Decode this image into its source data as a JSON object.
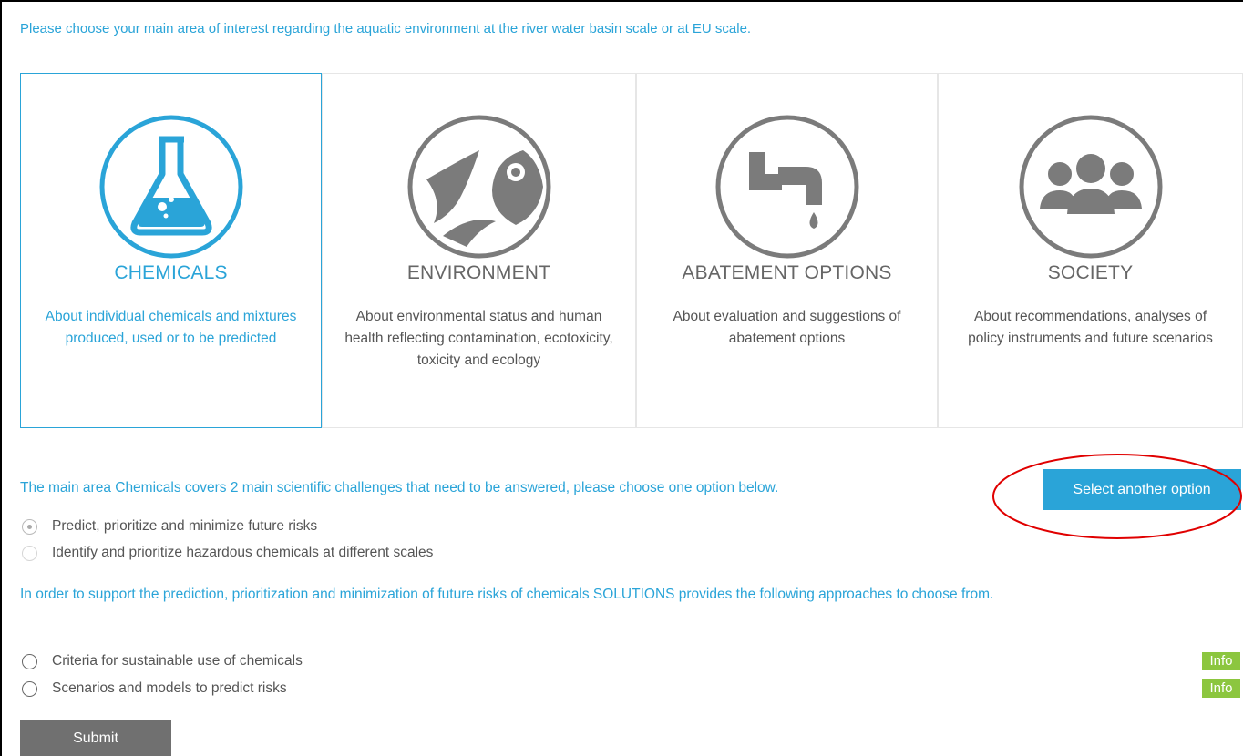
{
  "intro": "Please choose your main area of interest regarding the aquatic environment at the river water basin scale or at EU scale.",
  "colors": {
    "accent": "#2aa4d8",
    "icon_gray": "#7b7b7b",
    "info_green": "#8cc63f",
    "submit_gray": "#707070",
    "annotation_red": "#e00000"
  },
  "cards": [
    {
      "icon": "flask-icon",
      "title": "CHEMICALS",
      "desc": "About individual chemicals and mixtures produced, used or to be predicted",
      "selected": true
    },
    {
      "icon": "fish-plant-icon",
      "title": "ENVIRONMENT",
      "desc": "About environmental status and human health reflecting contamination, ecotoxicity, toxicity and ecology",
      "selected": false
    },
    {
      "icon": "faucet-drop-icon",
      "title": "ABATEMENT OPTIONS",
      "desc": "About evaluation and suggestions of abatement options",
      "selected": false
    },
    {
      "icon": "people-group-icon",
      "title": "SOCIETY",
      "desc": "About recommendations, analyses of policy instruments and future scenarios",
      "selected": false
    }
  ],
  "challenge": {
    "text": "The main area Chemicals covers 2 main scientific challenges that need to be answered, please choose one option below.",
    "select_button": "Select another option",
    "options": [
      {
        "label": "Predict, prioritize and minimize future risks",
        "checked": true
      },
      {
        "label": "Identify and prioritize hazardous chemicals at different scales",
        "checked": false
      }
    ]
  },
  "approaches": {
    "text": "In order to support the prediction, prioritization and minimization of future risks of chemicals SOLUTIONS provides the following approaches to choose from.",
    "options": [
      {
        "label": "Criteria for sustainable use of chemicals",
        "checked": false,
        "info": "Info"
      },
      {
        "label": "Scenarios and models to predict risks",
        "checked": false,
        "info": "Info"
      }
    ]
  },
  "submit_label": "Submit"
}
